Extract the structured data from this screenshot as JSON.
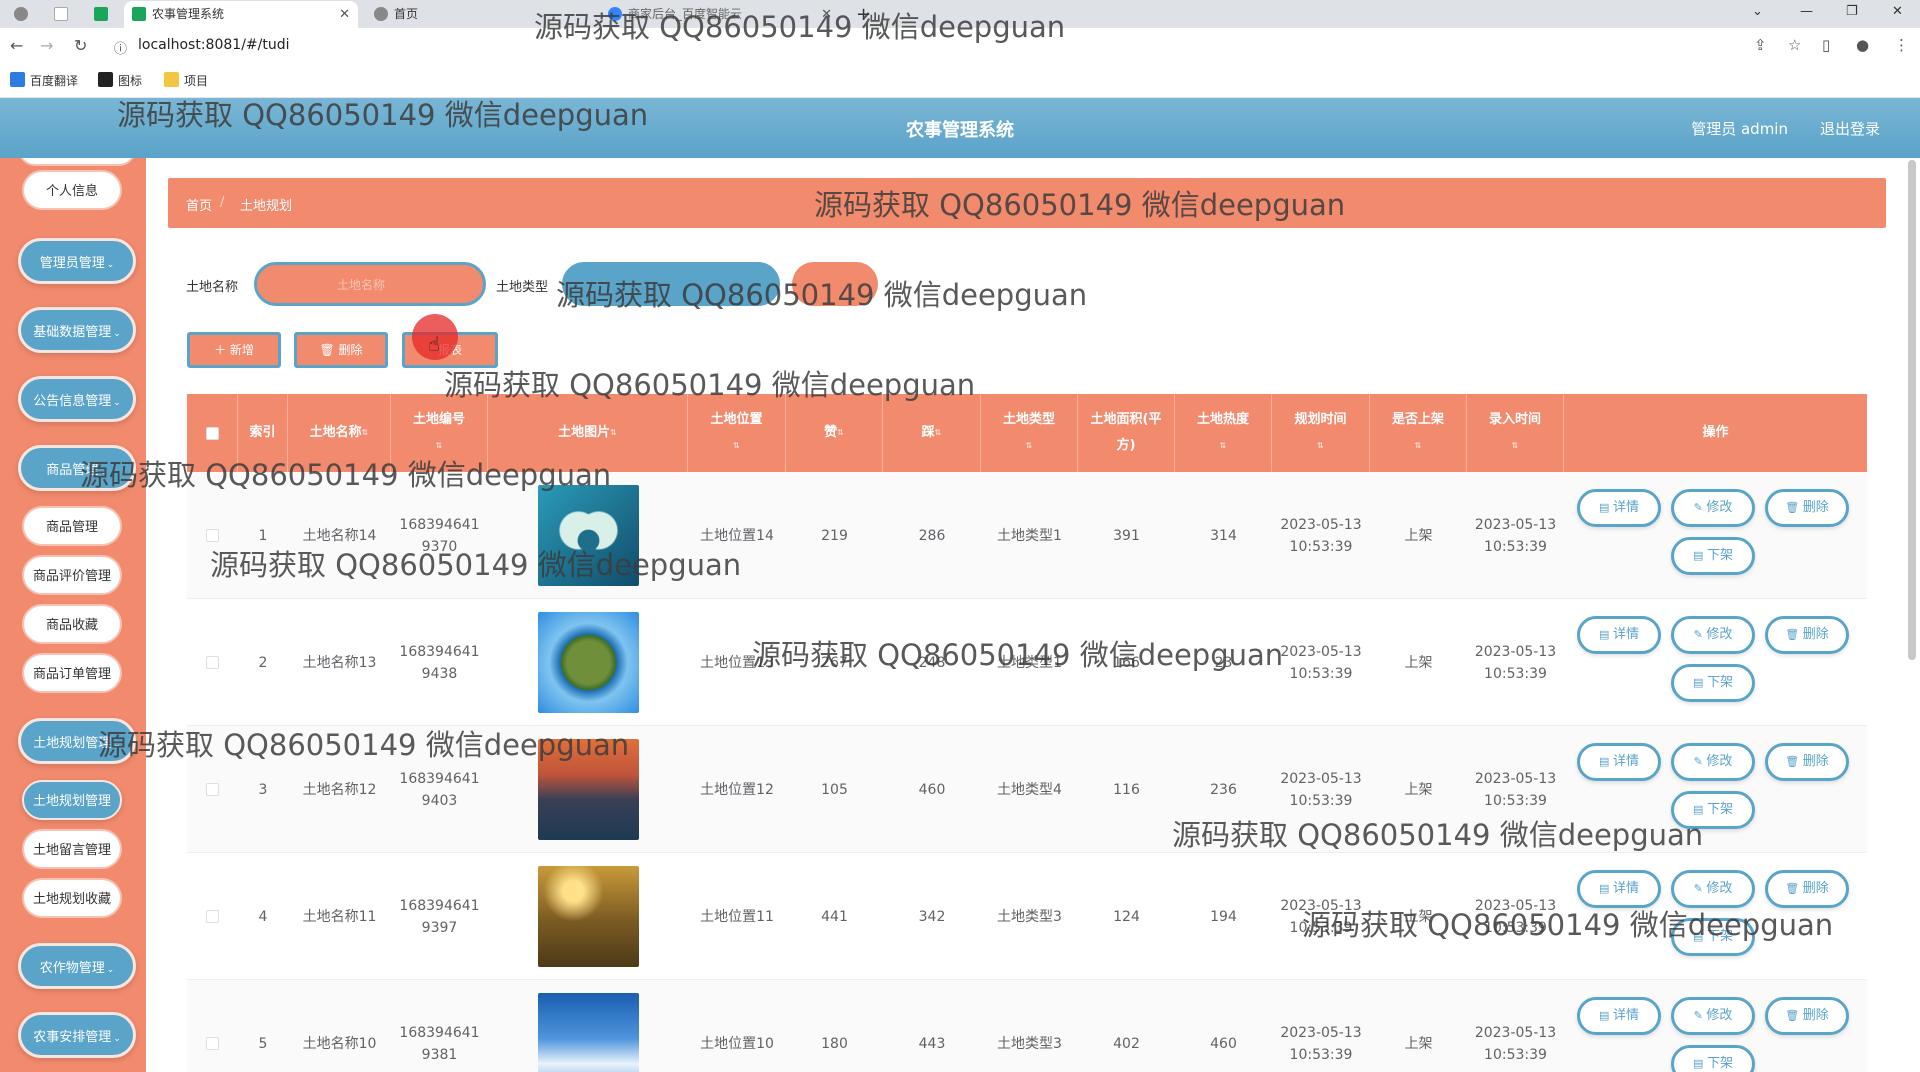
{
  "browser": {
    "tabs": [
      {
        "label": "",
        "active": false
      },
      {
        "label": "",
        "active": false
      },
      {
        "label": "农事管理系统",
        "active": true
      },
      {
        "label": "首页",
        "active": false
      },
      {
        "label": "商家后台_百度智能云",
        "active": false
      }
    ],
    "url": "localhost:8081/#/tudi",
    "bookmarks": [
      "百度翻译",
      "图标",
      "项目"
    ]
  },
  "header": {
    "title": "农事管理系统",
    "user": "管理员 admin",
    "logout": "退出登录"
  },
  "sidebar": {
    "items": [
      {
        "label": "个人信息",
        "style": "white"
      },
      {
        "label": "管理员管理",
        "style": "blue",
        "chevron": true
      },
      {
        "label": "基础数据管理",
        "style": "blue",
        "chevron": true
      },
      {
        "label": "公告信息管理",
        "style": "blue",
        "chevron": true
      },
      {
        "label": "商品管理",
        "style": "blue",
        "chevron": true
      },
      {
        "label": "商品管理",
        "style": "white"
      },
      {
        "label": "商品评价管理",
        "style": "white"
      },
      {
        "label": "商品收藏",
        "style": "white"
      },
      {
        "label": "商品订单管理",
        "style": "white"
      },
      {
        "label": "土地规划管理",
        "style": "blue",
        "chevron": true
      },
      {
        "label": "土地规划管理",
        "style": "blue-active"
      },
      {
        "label": "土地留言管理",
        "style": "white"
      },
      {
        "label": "土地规划收藏",
        "style": "white"
      },
      {
        "label": "农作物管理",
        "style": "blue",
        "chevron": true
      },
      {
        "label": "农事安排管理",
        "style": "blue",
        "chevron": true
      }
    ]
  },
  "breadcrumb": {
    "home": "首页",
    "sep": "/",
    "current": "土地规划"
  },
  "filters": {
    "name_label": "土地名称",
    "name_placeholder": "土地名称",
    "type_label": "土地类型"
  },
  "actions": {
    "add": "＋ 新增",
    "delete": "🗑 删除",
    "report": "报表"
  },
  "table": {
    "columns": [
      "",
      "索引",
      "土地名称",
      "土地编号",
      "土地图片",
      "土地位置",
      "赞",
      "踩",
      "土地类型",
      "土地面积(平方)",
      "土地热度",
      "规划时间",
      "是否上架",
      "录入时间",
      "操作"
    ],
    "rows": [
      {
        "index": "1",
        "name": "土地名称14",
        "code": "1683946419370",
        "location": "土地位置14",
        "up": "219",
        "down": "286",
        "type": "土地类型1",
        "area": "391",
        "heat": "314",
        "plan_time": "2023-05-13 10:53:39",
        "listed": "上架",
        "entry_time": "2023-05-13 10:53:39",
        "img": "heart"
      },
      {
        "index": "2",
        "name": "土地名称13",
        "code": "1683946419438",
        "location": "土地位置13",
        "up": "267",
        "down": "248",
        "type": "土地类型1",
        "area": "166",
        "heat": "23",
        "plan_time": "2023-05-13 10:53:39",
        "listed": "上架",
        "entry_time": "2023-05-13 10:53:39",
        "img": "globe"
      },
      {
        "index": "3",
        "name": "土地名称12",
        "code": "1683946419403",
        "location": "土地位置12",
        "up": "105",
        "down": "460",
        "type": "土地类型4",
        "area": "116",
        "heat": "236",
        "plan_time": "2023-05-13 10:53:39",
        "listed": "上架",
        "entry_time": "2023-05-13 10:53:39",
        "img": "sunset"
      },
      {
        "index": "4",
        "name": "土地名称11",
        "code": "1683946419397",
        "location": "土地位置11",
        "up": "441",
        "down": "342",
        "type": "土地类型3",
        "area": "124",
        "heat": "194",
        "plan_time": "2023-05-13 10:53:39",
        "listed": "上架",
        "entry_time": "2023-05-13 10:53:39",
        "img": "field"
      },
      {
        "index": "5",
        "name": "土地名称10",
        "code": "1683946419381",
        "location": "土地位置10",
        "up": "180",
        "down": "443",
        "type": "土地类型3",
        "area": "402",
        "heat": "460",
        "plan_time": "2023-05-13 10:53:39",
        "listed": "上架",
        "entry_time": "2023-05-13 10:53:39",
        "img": "sky"
      }
    ],
    "ops": {
      "detail": "详情",
      "edit": "修改",
      "delete": "删除",
      "unlist": "下架"
    }
  },
  "watermark": "源码获取 QQ86050149 微信deepguan",
  "colors": {
    "accent": "#f28a6e",
    "primary": "#5aa3c9"
  }
}
